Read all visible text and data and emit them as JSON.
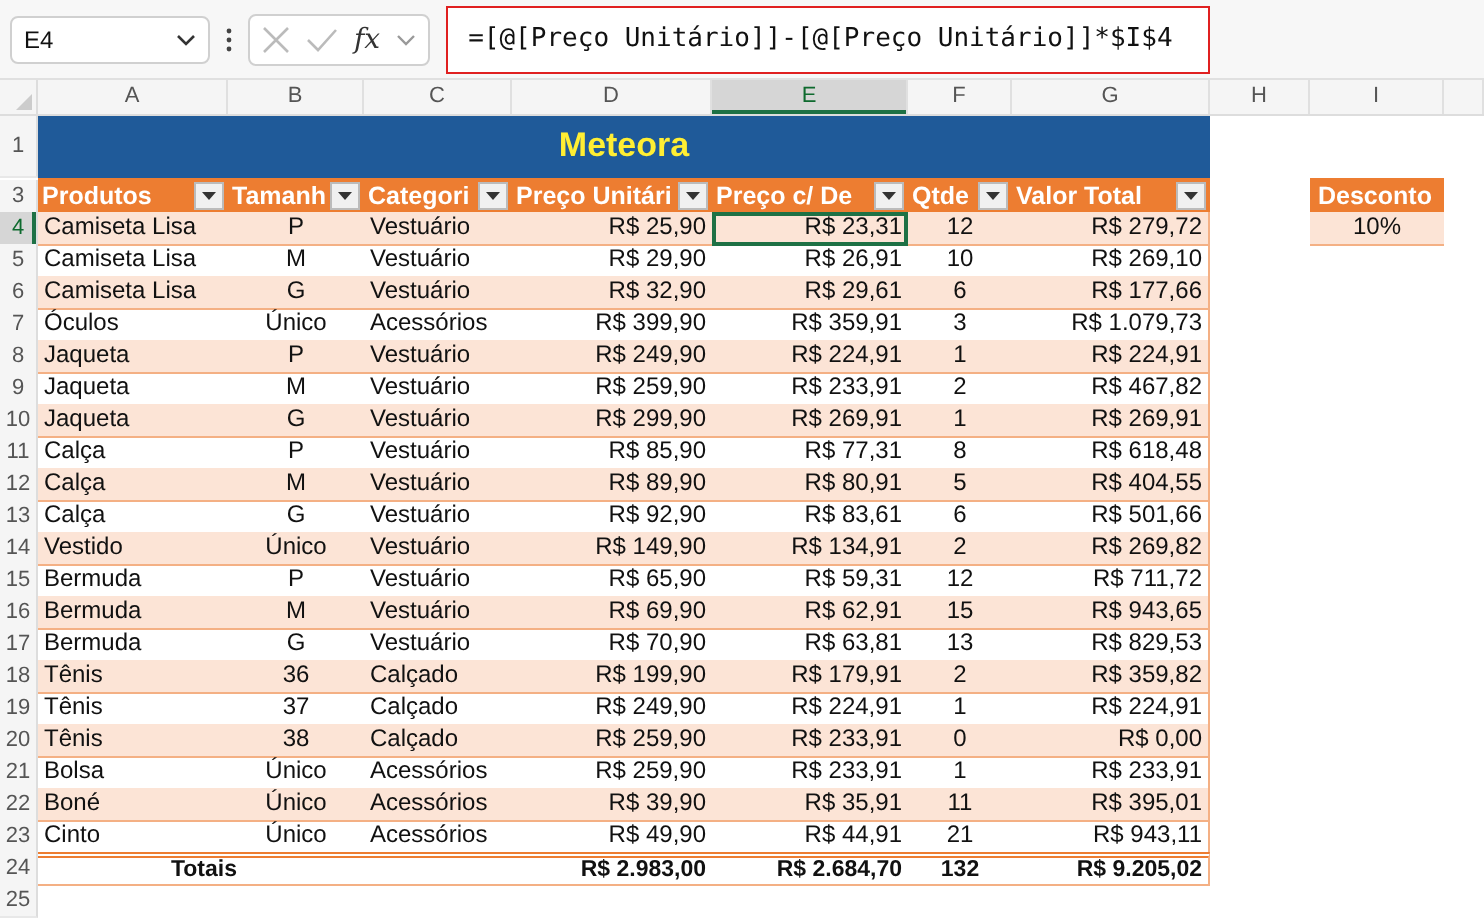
{
  "name_box": "E4",
  "fx_label": "fx",
  "formula": "=[@[Preço Unitário]]-[@[Preço Unitário]]*$I$4",
  "column_letters": [
    {
      "label": "A",
      "selected": false
    },
    {
      "label": "B",
      "selected": false
    },
    {
      "label": "C",
      "selected": false
    },
    {
      "label": "D",
      "selected": false
    },
    {
      "label": "E",
      "selected": true
    },
    {
      "label": "F",
      "selected": false
    },
    {
      "label": "G",
      "selected": false
    },
    {
      "label": "H",
      "selected": false
    },
    {
      "label": "I",
      "selected": false
    }
  ],
  "title_row": {
    "number": "1",
    "title": "Meteora"
  },
  "header_row": {
    "number": "3",
    "headers": [
      "Produtos",
      "Tamanh",
      "Categori",
      "Preço Unitári",
      "Preço c/ De",
      "Qtde",
      "Valor Total"
    ],
    "discount_label": "Desconto"
  },
  "rows": [
    {
      "number": "4",
      "selected": true,
      "cells": [
        "Camiseta Lisa",
        "P",
        "Vestuário",
        "R$ 25,90",
        "R$ 23,31",
        "12",
        "R$ 279,72"
      ],
      "discount_value": "10%"
    },
    {
      "number": "5",
      "selected": false,
      "cells": [
        "Camiseta Lisa",
        "M",
        "Vestuário",
        "R$ 29,90",
        "R$ 26,91",
        "10",
        "R$ 269,10"
      ]
    },
    {
      "number": "6",
      "selected": false,
      "cells": [
        "Camiseta Lisa",
        "G",
        "Vestuário",
        "R$ 32,90",
        "R$ 29,61",
        "6",
        "R$ 177,66"
      ]
    },
    {
      "number": "7",
      "selected": false,
      "cells": [
        "Óculos",
        "Único",
        "Acessórios",
        "R$ 399,90",
        "R$ 359,91",
        "3",
        "R$ 1.079,73"
      ]
    },
    {
      "number": "8",
      "selected": false,
      "cells": [
        "Jaqueta",
        "P",
        "Vestuário",
        "R$ 249,90",
        "R$ 224,91",
        "1",
        "R$ 224,91"
      ]
    },
    {
      "number": "9",
      "selected": false,
      "cells": [
        "Jaqueta",
        "M",
        "Vestuário",
        "R$ 259,90",
        "R$ 233,91",
        "2",
        "R$ 467,82"
      ]
    },
    {
      "number": "10",
      "selected": false,
      "cells": [
        "Jaqueta",
        "G",
        "Vestuário",
        "R$ 299,90",
        "R$ 269,91",
        "1",
        "R$ 269,91"
      ]
    },
    {
      "number": "11",
      "selected": false,
      "cells": [
        "Calça",
        "P",
        "Vestuário",
        "R$ 85,90",
        "R$ 77,31",
        "8",
        "R$ 618,48"
      ]
    },
    {
      "number": "12",
      "selected": false,
      "cells": [
        "Calça",
        "M",
        "Vestuário",
        "R$ 89,90",
        "R$ 80,91",
        "5",
        "R$ 404,55"
      ]
    },
    {
      "number": "13",
      "selected": false,
      "cells": [
        "Calça",
        "G",
        "Vestuário",
        "R$ 92,90",
        "R$ 83,61",
        "6",
        "R$ 501,66"
      ]
    },
    {
      "number": "14",
      "selected": false,
      "cells": [
        "Vestido",
        "Único",
        "Vestuário",
        "R$ 149,90",
        "R$ 134,91",
        "2",
        "R$ 269,82"
      ]
    },
    {
      "number": "15",
      "selected": false,
      "cells": [
        "Bermuda",
        "P",
        "Vestuário",
        "R$ 65,90",
        "R$ 59,31",
        "12",
        "R$ 711,72"
      ]
    },
    {
      "number": "16",
      "selected": false,
      "cells": [
        "Bermuda",
        "M",
        "Vestuário",
        "R$ 69,90",
        "R$ 62,91",
        "15",
        "R$ 943,65"
      ]
    },
    {
      "number": "17",
      "selected": false,
      "cells": [
        "Bermuda",
        "G",
        "Vestuário",
        "R$ 70,90",
        "R$ 63,81",
        "13",
        "R$ 829,53"
      ]
    },
    {
      "number": "18",
      "selected": false,
      "cells": [
        "Tênis",
        "36",
        "Calçado",
        "R$ 199,90",
        "R$ 179,91",
        "2",
        "R$ 359,82"
      ]
    },
    {
      "number": "19",
      "selected": false,
      "cells": [
        "Tênis",
        "37",
        "Calçado",
        "R$ 249,90",
        "R$ 224,91",
        "1",
        "R$ 224,91"
      ]
    },
    {
      "number": "20",
      "selected": false,
      "cells": [
        "Tênis",
        "38",
        "Calçado",
        "R$ 259,90",
        "R$ 233,91",
        "0",
        "R$ 0,00"
      ]
    },
    {
      "number": "21",
      "selected": false,
      "cells": [
        "Bolsa",
        "Único",
        "Acessórios",
        "R$ 259,90",
        "R$ 233,91",
        "1",
        "R$ 233,91"
      ]
    },
    {
      "number": "22",
      "selected": false,
      "cells": [
        "Boné",
        "Único",
        "Acessórios",
        "R$ 39,90",
        "R$ 35,91",
        "11",
        "R$ 395,01"
      ]
    },
    {
      "number": "23",
      "selected": false,
      "cells": [
        "Cinto",
        "Único",
        "Acessórios",
        "R$ 49,90",
        "R$ 44,91",
        "21",
        "R$ 943,11"
      ]
    }
  ],
  "totals_row": {
    "number": "24",
    "label": "Totais",
    "price_total": "R$ 2.983,00",
    "discounted_total": "R$ 2.684,70",
    "quantity_total": "132",
    "value_total": "R$ 9.205,02"
  },
  "empty_rows": [
    "25"
  ]
}
